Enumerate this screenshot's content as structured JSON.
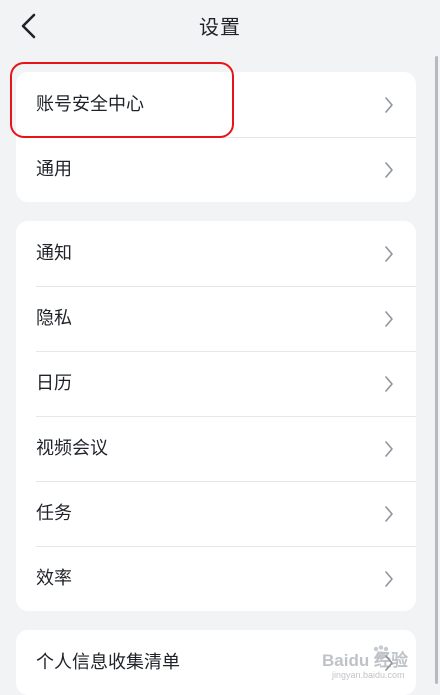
{
  "header": {
    "title": "设置",
    "back_icon": "chevron-left-icon"
  },
  "groups": [
    {
      "items": [
        {
          "label": "账号安全中心",
          "icon": "chevron-right-icon"
        },
        {
          "label": "通用",
          "icon": "chevron-right-icon"
        }
      ]
    },
    {
      "items": [
        {
          "label": "通知",
          "icon": "chevron-right-icon"
        },
        {
          "label": "隐私",
          "icon": "chevron-right-icon"
        },
        {
          "label": "日历",
          "icon": "chevron-right-icon"
        },
        {
          "label": "视频会议",
          "icon": "chevron-right-icon"
        },
        {
          "label": "任务",
          "icon": "chevron-right-icon"
        },
        {
          "label": "效率",
          "icon": "chevron-right-icon"
        }
      ]
    },
    {
      "items": [
        {
          "label": "个人信息收集清单",
          "icon": "chevron-right-icon"
        }
      ]
    }
  ],
  "annotation": {
    "highlight_color": "#e8141b"
  },
  "watermark": {
    "text": "Baidu 经验",
    "subtext": "jingyan.baidu.com"
  }
}
